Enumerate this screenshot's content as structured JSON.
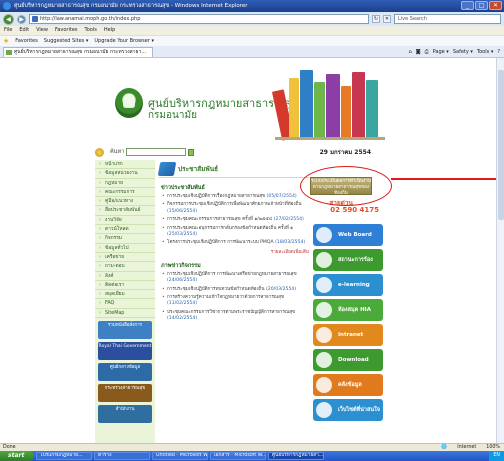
{
  "window": {
    "title": "ศูนย์บริหารกฎหมายสาธารณสุข กรมอนามัย กระทรวงสาธารณสุข - Windows Internet Explorer"
  },
  "address": {
    "url": "http://law.anamai.moph.go.th/index.php",
    "search_placeholder": "Live Search"
  },
  "menu": [
    "File",
    "Edit",
    "View",
    "Favorites",
    "Tools",
    "Help"
  ],
  "favorites": {
    "label": "Favorites",
    "suggested": "Suggested Sites ▾",
    "upgrade": "Upgrade Your Browser ▾"
  },
  "tab": {
    "label": "ศูนย์บริหารกฎหมายสาธารณสุข กรมอนามัย กระทรวงสาธา..."
  },
  "commands": [
    "Page ▾",
    "Safety ▾",
    "Tools ▾"
  ],
  "site": {
    "title": "ศูนย์บริหารกฎหมายสาธารณสุข",
    "subtitle": "กรมอนามัย",
    "search_label": "ค้นหา",
    "date": "29 มกราคม 2554",
    "info_box": "ระบบประเมินผลการดำเนินงานตามกฎหมายสาธารณสุขของท้องถิ่น"
  },
  "leftnav": {
    "items": [
      "หน้าแรก",
      "ข้อมูลหน่วยงาน",
      "กฎหมาย",
      "คณะกรรมการ",
      "คู่มือ/แนวทาง",
      "สื่อประชาสัมพันธ์",
      "งานวิจัย",
      "ดาวน์โหลด",
      "กิจกรรม",
      "ข้อมูลทั่วไป",
      "เครือข่าย",
      "ถาม-ตอบ",
      "ลิงค์",
      "ติดต่อเรา",
      "สมุดเยี่ยม",
      "FAQ",
      "SiteMap"
    ],
    "banners": [
      {
        "label": "รวมหนังสือสั่งการ",
        "color": "#3f7fc4"
      },
      {
        "label": "Royal Thai Government",
        "color": "#2c4e9e"
      },
      {
        "label": "ศูนย์กลางข้อมูล",
        "color": "#2f6aa8"
      },
      {
        "label": "กระทรวงสาธารณสุข",
        "color": "#8a5a1c"
      },
      {
        "label": "สำนักงาน",
        "color": "#2f6e9e"
      }
    ]
  },
  "main": {
    "heading": "ประชาสัมพันธ์",
    "sections": [
      {
        "title": "ข่าวประชาสัมพันธ์",
        "items": [
          {
            "text": "การประชุมเชิงปฏิบัติการเรื่องกฎหมายสาธารณสุข",
            "date": "(05/07/2554)"
          },
          {
            "text": "กิจกรรมการประชุมเชิงปฏิบัติการเพื่อพัฒนาศักยภาพเจ้าหน้าที่ท้องถิ่น",
            "date": "(15/06/2554)"
          },
          {
            "text": "การประชุมคณะกรรมการสาธารณสุข ครั้งที่ ๑/๒๕๕๔",
            "date": "(27/02/2554)"
          },
          {
            "text": "การประชุมคณะอนุกรรมการกลั่นกรองข้อกำหนดท้องถิ่น ครั้งที่ ๑",
            "date": "(25/03/2554)"
          },
          {
            "text": "โครงการประชุมเชิงปฏิบัติการ การพัฒนาระบบ PMQA",
            "date": "(18/03/2554)"
          }
        ],
        "more": "รายละเอียดเพิ่มเติม"
      },
      {
        "title": "ภาพข่าวกิจกรรม",
        "items": [
          {
            "text": "การประชุมเชิงปฏิบัติการ การพัฒนาเครือข่ายกฎหมายสาธารณสุข",
            "date": "(24/06/2554)"
          },
          {
            "text": "การประชุมเชิงปฏิบัติการทบทวนข้อกำหนดท้องถิ่น",
            "date": "(20/03/2554)"
          },
          {
            "text": "การสร้างความรู้ความเข้าใจกฎหมายว่าด้วยการสาธารณสุข",
            "date": "(11/02/2554)"
          },
          {
            "text": "ประชุมคณะกรรมการวิชาการตามพระราชบัญญัติการสาธารณสุข",
            "date": "(14/02/2554)"
          }
        ]
      }
    ]
  },
  "rightcol": {
    "hotline_prefix": "สายด่วน",
    "phone": "02 590 4175",
    "banners": [
      {
        "label": "Web Board",
        "color": "#2f7fd4"
      },
      {
        "label": "สถานะการร้องเรียน",
        "color": "#3c9a2e"
      },
      {
        "label": "e-learning",
        "color": "#2b8fd0"
      },
      {
        "label": "ห้องสมุด HIA LAW",
        "color": "#4caa3a"
      },
      {
        "label": "Intranet",
        "color": "#e1891c"
      },
      {
        "label": "Download",
        "color": "#3c9a2e"
      },
      {
        "label": "คลังข้อมูล",
        "color": "#e07a1c"
      },
      {
        "label": "เว็บไซต์ที่น่าสนใจ",
        "color": "#2b8fd0"
      }
    ]
  },
  "status": {
    "left": "Done",
    "zone": "Internet",
    "zoom": "100%"
  },
  "taskbar": {
    "start": "start",
    "tasks": [
      "โปรแกรมกฎหมาย...",
      "ตาราง",
      "Untitled - Microsoft Word",
      "เอกสาร - Microsoft W...",
      "ศูนย์บริหารกฎหมายสา..."
    ],
    "tray": "EN"
  }
}
